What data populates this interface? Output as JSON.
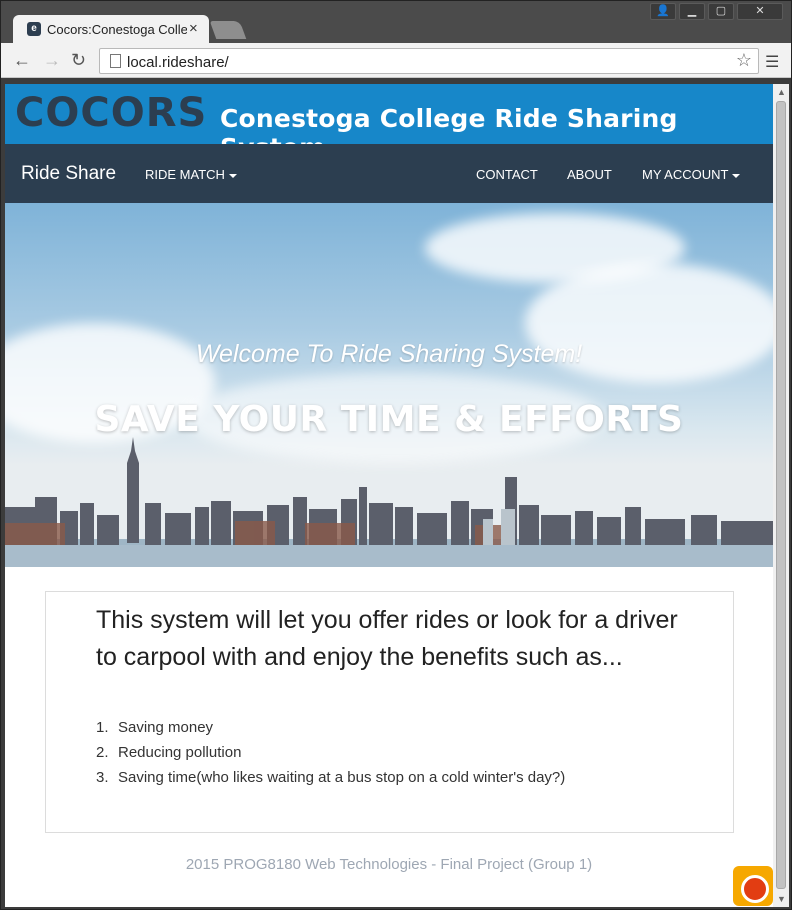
{
  "browser": {
    "tab_title": "Cocors:Conestoga Colleg",
    "tab_favicon": "page-favicon",
    "tab_close": "×",
    "url": "local.rideshare/",
    "window_buttons": [
      "person",
      "minimize",
      "maximize",
      "close"
    ]
  },
  "site": {
    "logo": "COCORS",
    "title": "Conestoga College Ride Sharing System"
  },
  "nav": {
    "brand": "Ride Share",
    "left_items": [
      {
        "label": "RIDE MATCH",
        "dropdown": true
      }
    ],
    "right_items": [
      {
        "label": "CONTACT",
        "dropdown": false
      },
      {
        "label": "ABOUT",
        "dropdown": false
      },
      {
        "label": "MY ACCOUNT",
        "dropdown": true
      }
    ]
  },
  "hero": {
    "subtitle": "Welcome To Ride Sharing System!",
    "title": "SAVE YOUR TIME & EFFORTS"
  },
  "content": {
    "intro": "This system will let you offer rides or look for a driver to carpool with and enjoy the benefits such as...",
    "benefits": [
      {
        "num": "1.",
        "text": "Saving money"
      },
      {
        "num": "2.",
        "text": "Reducing pollution"
      },
      {
        "num": "3.",
        "text": "Saving time(who likes waiting at a bus stop on a cold winter's day?)"
      }
    ]
  },
  "footer": {
    "text": "2015 PROG8180 Web Technologies - Final Project (Group 1)"
  },
  "colors": {
    "banner": "#1787c9",
    "navbar": "#2c3e50",
    "footer_text": "#9ea7b3"
  }
}
